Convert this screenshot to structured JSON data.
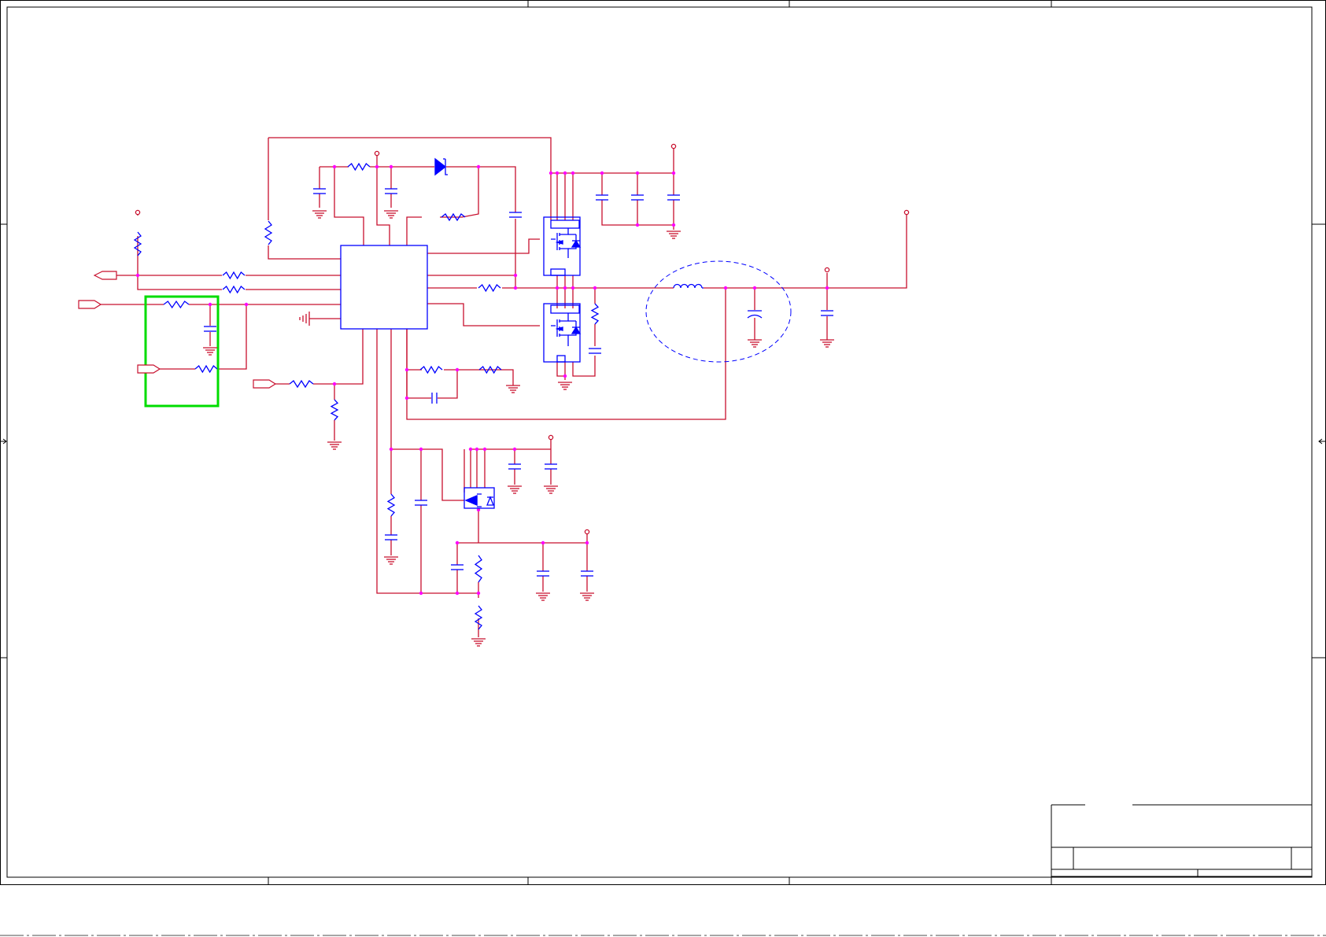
{
  "colors": {
    "wire": "#c8102e",
    "component": "#0000ff",
    "highlight": "#00dd00"
  }
}
